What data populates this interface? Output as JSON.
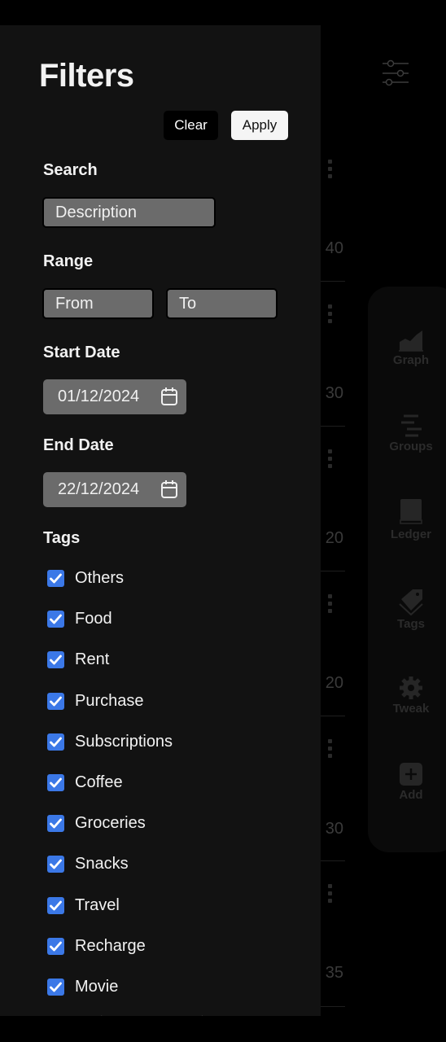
{
  "background": {
    "row_amounts": [
      "40",
      "30",
      "20",
      "20",
      "30",
      "35"
    ],
    "nav_items": [
      {
        "label": "Graph",
        "icon": "chart-area-icon"
      },
      {
        "label": "Groups",
        "icon": "groups-list-icon"
      },
      {
        "label": "Ledger",
        "icon": "book-icon"
      },
      {
        "label": "Tags",
        "icon": "tags-icon"
      },
      {
        "label": "Tweak",
        "icon": "gear-icon"
      },
      {
        "label": "Add",
        "icon": "add-square-icon"
      }
    ]
  },
  "filters": {
    "title": "Filters",
    "clear_label": "Clear",
    "apply_label": "Apply",
    "search": {
      "label": "Search",
      "placeholder": "Description"
    },
    "range": {
      "label": "Range",
      "from_placeholder": "From",
      "to_placeholder": "To"
    },
    "start_date": {
      "label": "Start Date",
      "value": "01/12/2024"
    },
    "end_date": {
      "label": "End Date",
      "value": "22/12/2024"
    },
    "tags": {
      "label": "Tags",
      "items": [
        {
          "label": "Others",
          "checked": true
        },
        {
          "label": "Food",
          "checked": true
        },
        {
          "label": "Rent",
          "checked": true
        },
        {
          "label": "Purchase",
          "checked": true
        },
        {
          "label": "Subscriptions",
          "checked": true
        },
        {
          "label": "Coffee",
          "checked": true
        },
        {
          "label": "Groceries",
          "checked": true
        },
        {
          "label": "Snacks",
          "checked": true
        },
        {
          "label": "Travel",
          "checked": true
        },
        {
          "label": "Recharge",
          "checked": true
        },
        {
          "label": "Movie",
          "checked": true
        }
      ]
    }
  },
  "colors": {
    "checkbox": "#3b78e7",
    "drawer_bg": "#121212",
    "input_bg": "#6b6b6b"
  }
}
